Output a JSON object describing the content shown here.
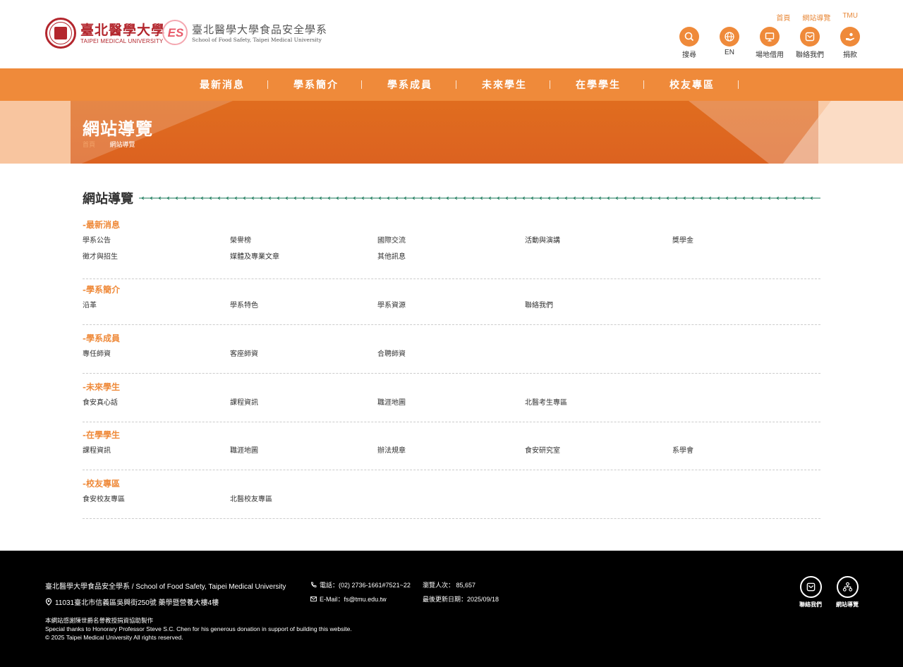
{
  "header": {
    "university": {
      "name_cn": "臺北醫學大學",
      "name_en": "TAIPEI MEDICAL UNIVERSITY"
    },
    "department": {
      "name_cn": "臺北醫學大學食品安全學系",
      "name_en": "School of Food Safety, Taipei Medical University"
    },
    "top_links": [
      "首頁",
      "網站導覽",
      "TMU"
    ],
    "quick_links": [
      {
        "label": "搜尋",
        "icon": "search-icon"
      },
      {
        "label": "EN",
        "icon": "globe-icon"
      },
      {
        "label": "場地借用",
        "icon": "presentation-icon"
      },
      {
        "label": "聯絡我們",
        "icon": "mail-icon"
      },
      {
        "label": "捐款",
        "icon": "donate-icon"
      }
    ]
  },
  "nav": [
    "最新消息",
    "學系簡介",
    "學系成員",
    "未來學生",
    "在學學生",
    "校友專區"
  ],
  "banner": {
    "title": "網站導覽",
    "breadcrumb": [
      "首頁",
      "網站導覽"
    ]
  },
  "sitemap": {
    "title": "網站導覽",
    "groups": [
      {
        "title": "-最新消息",
        "items": [
          "學系公告",
          "榮譽榜",
          "國際交流",
          "活動與演講",
          "獎學金",
          "徵才與招生",
          "媒體及專業文章",
          "其他訊息"
        ]
      },
      {
        "title": "-學系簡介",
        "items": [
          "沿革",
          "學系特色",
          "學系資源",
          "聯絡我們"
        ]
      },
      {
        "title": "-學系成員",
        "items": [
          "專任師資",
          "客座師資",
          "合聘師資"
        ]
      },
      {
        "title": "-未來學生",
        "items": [
          "食安真心話",
          "課程資訊",
          "職涯地圖",
          "北醫考生專區"
        ]
      },
      {
        "title": "-在學學生",
        "items": [
          "課程資訊",
          "職涯地圖",
          "辦法規章",
          "食安研究室",
          "系學會"
        ]
      },
      {
        "title": "-校友專區",
        "items": [
          "食安校友專區",
          "北醫校友專區"
        ]
      }
    ]
  },
  "footer": {
    "name": "臺北醫學大學食品安全學系 / School of Food Safety, Taipei Medical University",
    "address": "11031臺北市信義區吳興街250號 藥學暨營養大樓4樓",
    "phone": "電話：(02) 2736-1661#7521~22",
    "email": "E-Mail：fs@tmu.edu.tw",
    "visitors": "瀏覽人次： 85,657",
    "updated": "最後更新日期：2025/09/18",
    "thanks_cn": "本網站感謝陳世爵名譽教授捐資協助製作",
    "thanks_en": "Special thanks to Honorary Professor Steve S.C. Chen for his generous donation in support of building this website.",
    "copyright": "© 2025 Taipei Medical University All rights reserved.",
    "buttons": [
      {
        "label": "聯絡我們",
        "icon": "mail-icon"
      },
      {
        "label": "網站導覽",
        "icon": "sitemap-icon"
      }
    ]
  },
  "colors": {
    "accent": "#ef8a3a",
    "banner": "#dc6220",
    "brand_red": "#b3262d",
    "footer_bg": "#000000",
    "deco_green": "#1a7a5a"
  }
}
